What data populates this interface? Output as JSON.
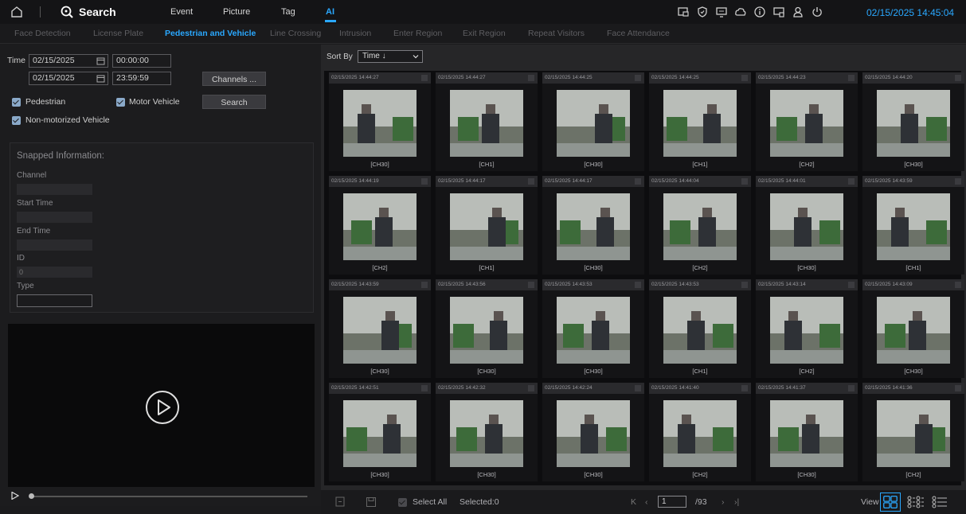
{
  "topbar": {
    "search_label": "Search",
    "menu": [
      {
        "label": "Event"
      },
      {
        "label": "Picture"
      },
      {
        "label": "Tag"
      },
      {
        "label": "AI",
        "active": true
      }
    ],
    "clock": "02/15/2025 14:45:04",
    "icons": [
      "home-icon",
      "search-icon",
      "playback-icon",
      "shield-icon",
      "monitor-chat-icon",
      "cloud-icon",
      "info-icon",
      "display-icon",
      "user-icon",
      "power-icon"
    ]
  },
  "subtabs": [
    {
      "label": "Face Detection"
    },
    {
      "label": "License Plate"
    },
    {
      "label": "Pedestrian and Vehicle",
      "active": true
    },
    {
      "label": "Line Crossing"
    },
    {
      "label": "Intrusion"
    },
    {
      "label": "Enter Region"
    },
    {
      "label": "Exit Region"
    },
    {
      "label": "Repeat Visitors"
    },
    {
      "label": "Face Attendance"
    }
  ],
  "filter": {
    "time_label": "Time",
    "start_date": "02/15/2025",
    "start_time": "00:00:00",
    "end_date": "02/15/2025",
    "end_time": "23:59:59",
    "channels_button": "Channels ...",
    "search_button": "Search",
    "pedestrian": {
      "label": "Pedestrian",
      "checked": true
    },
    "motor_vehicle": {
      "label": "Motor Vehicle",
      "checked": true
    },
    "non_motorized": {
      "label": "Non-motorized Vehicle",
      "checked": true
    }
  },
  "snapped": {
    "title": "Snapped Information:",
    "channel_label": "Channel",
    "channel_value": "",
    "start_label": "Start Time",
    "start_value": "",
    "end_label": "End Time",
    "end_value": "",
    "id_label": "ID",
    "id_value": "0",
    "type_label": "Type",
    "type_value": ""
  },
  "sort": {
    "label": "Sort By",
    "value": "Time ↓"
  },
  "results": [
    {
      "time": "02/15/2025 14:44:27",
      "channel": "[CH30]"
    },
    {
      "time": "02/15/2025 14:44:27",
      "channel": "[CH1]"
    },
    {
      "time": "02/15/2025 14:44:25",
      "channel": "[CH30]"
    },
    {
      "time": "02/15/2025 14:44:25",
      "channel": "[CH1]"
    },
    {
      "time": "02/15/2025 14:44:23",
      "channel": "[CH2]"
    },
    {
      "time": "02/15/2025 14:44:20",
      "channel": "[CH30]"
    },
    {
      "time": "02/15/2025 14:44:19",
      "channel": "[CH2]"
    },
    {
      "time": "02/15/2025 14:44:17",
      "channel": "[CH1]"
    },
    {
      "time": "02/15/2025 14:44:17",
      "channel": "[CH30]"
    },
    {
      "time": "02/15/2025 14:44:04",
      "channel": "[CH2]"
    },
    {
      "time": "02/15/2025 14:44:01",
      "channel": "[CH30]"
    },
    {
      "time": "02/15/2025 14:43:59",
      "channel": "[CH1]"
    },
    {
      "time": "02/15/2025 14:43:59",
      "channel": "[CH30]"
    },
    {
      "time": "02/15/2025 14:43:56",
      "channel": "[CH30]"
    },
    {
      "time": "02/15/2025 14:43:53",
      "channel": "[CH30]"
    },
    {
      "time": "02/15/2025 14:43:53",
      "channel": "[CH1]"
    },
    {
      "time": "02/15/2025 14:43:14",
      "channel": "[CH2]"
    },
    {
      "time": "02/15/2025 14:43:09",
      "channel": "[CH30]"
    },
    {
      "time": "02/15/2025 14:42:51",
      "channel": "[CH30]"
    },
    {
      "time": "02/15/2025 14:42:32",
      "channel": "[CH30]"
    },
    {
      "time": "02/15/2025 14:42:24",
      "channel": "[CH30]"
    },
    {
      "time": "02/15/2025 14:41:40",
      "channel": "[CH2]"
    },
    {
      "time": "02/15/2025 14:41:37",
      "channel": "[CH30]"
    },
    {
      "time": "02/15/2025 14:41:36",
      "channel": "[CH2]"
    }
  ],
  "bottom": {
    "select_all": "Select All",
    "selected": "Selected:0",
    "page": "1",
    "total_pages": "/93",
    "view_label": "View"
  },
  "colors": {
    "accent": "#2aa8ff",
    "background": "#1b1b1d"
  }
}
